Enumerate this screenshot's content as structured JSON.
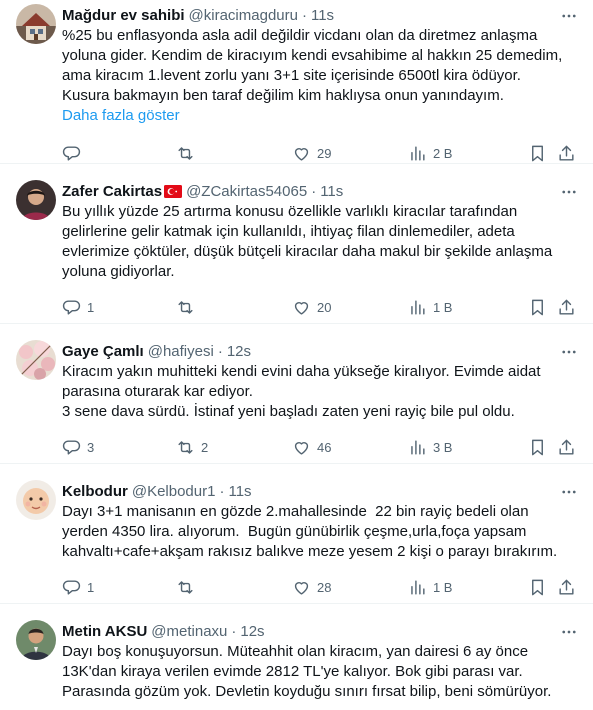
{
  "tweets": [
    {
      "name": "Mağdur ev sahibi",
      "handle": "@kiracimagduru",
      "separator": "·",
      "time": "11s",
      "text": "%25 bu enflasyonda asla adil değildir vicdanı olan da diretmez anlaşma\nyoluna gider. Kendim de kiracıyım kendi evsahibime al hakkın 25 demedim,\nama kiracım 1.levent zorlu yanı 3+1 site içerisinde 6500tl kira ödüyor.\nKusura bakmayın ben taraf değilim kim haklıysa onun yanındayım.",
      "show_more": "Daha fazla göster",
      "replies": "",
      "retweets": "",
      "likes": "29",
      "views": "2 B"
    },
    {
      "name": "Zafer Cakirtas",
      "handle": "@ZCakirtas54065",
      "separator": "·",
      "time": "11s",
      "text": "Bu yıllık yüzde 25 artırma konusu özellikle varlıklı kiracılar tarafından\ngelirlerine gelir katmak için kullanıldı, ihtiyaç filan dinlemediler, adeta\nevlerimize çöktüler, düşük bütçeli kiracılar daha makul bir şekilde anlaşma\nyoluna gidiyorlar.",
      "replies": "1",
      "retweets": "",
      "likes": "20",
      "views": "1 B"
    },
    {
      "name": "Gaye Çamlı",
      "handle": "@hafiyesi",
      "separator": "·",
      "time": "12s",
      "text": "Kiracım yakın muhitteki kendi evini daha yükseğe kiralıyor. Evimde aidat\nparasına oturarak kar ediyor.\n3 sene dava sürdü. İstinaf yeni başladı zaten yeni rayiç bile pul oldu.",
      "replies": "3",
      "retweets": "2",
      "likes": "46",
      "views": "3 B"
    },
    {
      "name": "Kelbodur",
      "handle": "@Kelbodur1",
      "separator": "·",
      "time": "11s",
      "text": "Dayı 3+1 manisanın en gözde 2.mahallesinde  22 bin rayiç bedeli olan\nyerden 4350 lira. alıyorum.  Bugün günübirlik çeşme,urla,foça yapsam\nkahvaltı+cafe+akşam rakısız balıkve meze yesem 2 kişi o parayı bırakırım.",
      "replies": "1",
      "retweets": "",
      "likes": "28",
      "views": "1 B"
    },
    {
      "name": "Metin AKSU",
      "handle": "@metinaxu",
      "separator": "·",
      "time": "12s",
      "text": "Dayı boş konuşuyorsun. Müteahhit olan kiracım, yan dairesi 6 ay önce\n13K'dan kiraya verilen evimde 2812 TL'ye kalıyor. Bok gibi parası var.\nParasında gözüm yok. Devletin koyduğu sınırı fırsat bilip, beni sömürüyor.",
      "replies": "",
      "retweets": "",
      "likes": "",
      "views": ""
    }
  ],
  "icons": {
    "more": "more-horizontal-icon",
    "reply": "reply-icon",
    "retweet": "retweet-icon",
    "like": "heart-icon",
    "views": "views-chart-icon",
    "bookmark": "bookmark-icon",
    "share": "share-icon",
    "flag": "turkey-flag-icon"
  },
  "colors": {
    "text": "#0f1419",
    "secondary": "#536471",
    "link": "#1d9bf0",
    "divider": "#eff3f4",
    "flag_red": "#e30a17"
  }
}
